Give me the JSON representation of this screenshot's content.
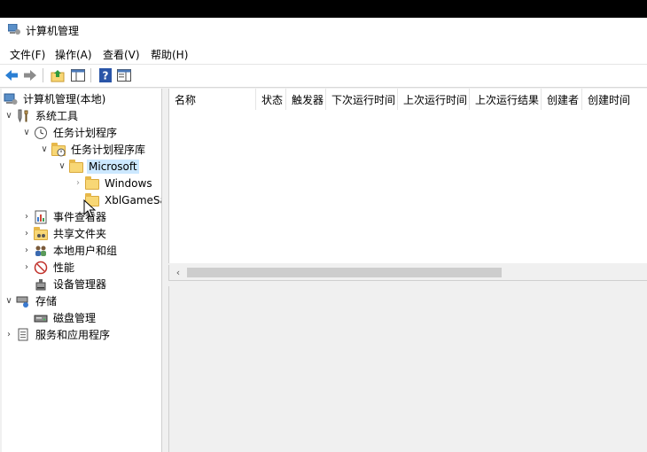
{
  "window": {
    "title": "计算机管理"
  },
  "menu": [
    "文件(F)",
    "操作(A)",
    "查看(V)",
    "帮助(H)"
  ],
  "toolbar": {
    "icons": [
      "back-arrow-icon",
      "forward-arrow-icon",
      "up-folder-icon",
      "show-hide-tree-icon",
      "help-icon",
      "properties-icon"
    ]
  },
  "tree": {
    "root": "计算机管理(本地)",
    "system_tools": "系统工具",
    "task_scheduler": "任务计划程序",
    "task_scheduler_library": "任务计划程序库",
    "microsoft": "Microsoft",
    "windows": "Windows",
    "xblgamesave": "XblGameSa",
    "event_viewer": "事件查看器",
    "shared_folders": "共享文件夹",
    "local_users_groups": "本地用户和组",
    "performance": "性能",
    "device_manager": "设备管理器",
    "storage": "存储",
    "disk_management": "磁盘管理",
    "services_apps": "服务和应用程序"
  },
  "columns": [
    "名称",
    "状态",
    "触发器",
    "下次运行时间",
    "上次运行时间",
    "上次运行结果",
    "创建者",
    "创建时间"
  ],
  "colors": {
    "selected": "#cce8ff",
    "folder": "#f8d775",
    "window_bg": "#f0f0f0"
  }
}
